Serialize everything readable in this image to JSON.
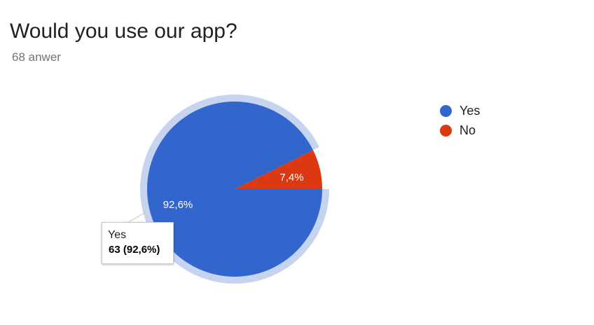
{
  "title": "Would you use our app?",
  "subtitle": "68 anwer",
  "chart_data": {
    "type": "pie",
    "title": "Would you use our app?",
    "subtitle": "68 anwer",
    "slices": [
      {
        "name": "Yes",
        "value": 63,
        "percent_label": "92,6%",
        "color": "#3366cc"
      },
      {
        "name": "No",
        "value": 5,
        "percent_label": "7,4%",
        "color": "#dc3912"
      }
    ],
    "highlighted_slice": "Yes",
    "legend_position": "right"
  },
  "tooltip": {
    "category": "Yes",
    "value_text": "63 (92,6%)"
  },
  "colors": {
    "highlight_ring": "#c6d4ef",
    "tooltip_border": "#c8c8c8"
  }
}
